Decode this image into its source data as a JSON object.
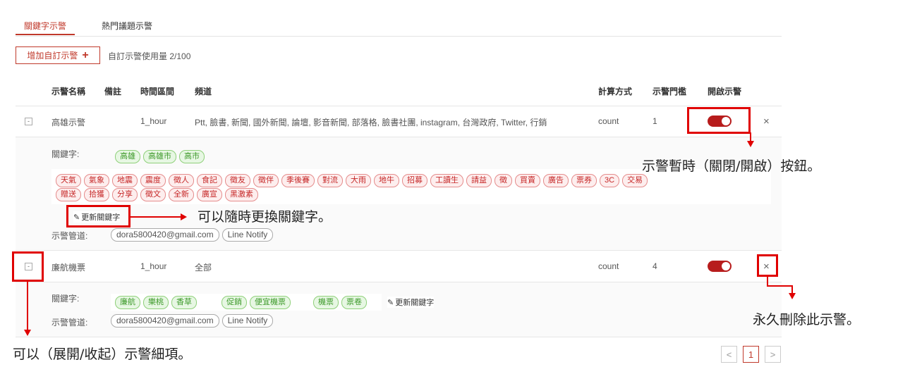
{
  "tabs": [
    {
      "label": "關鍵字示警",
      "active": true
    },
    {
      "label": "熱門議題示警",
      "active": false
    }
  ],
  "toolbar": {
    "add_label": "增加自訂示警",
    "add_icon": "plus-icon",
    "usage": "自訂示警使用量 2/100"
  },
  "columns": {
    "name": "示警名稱",
    "note": "備註",
    "interval": "時間區間",
    "channel": "頻道",
    "method": "計算方式",
    "threshold": "示警門檻",
    "enabled": "開啟示警"
  },
  "alerts": [
    {
      "expander": "-",
      "name": "高雄示警",
      "note": "",
      "interval": "1_hour",
      "channels": "Ptt, 臉書, 新聞, 國外新聞, 論壇, 影音新聞, 部落格, 臉書社團, instagram, 台灣政府, Twitter, 行銷",
      "method": "count",
      "threshold": "1",
      "enabled": true,
      "delete_icon": "×",
      "keywords_label": "關鍵字:",
      "keywords": [
        "高雄",
        "高雄市",
        "高市"
      ],
      "exclude_row1": [
        "天氣",
        "氣象",
        "地震",
        "震度",
        "徵人",
        "食記",
        "徵友",
        "徵伴",
        "季後賽",
        "對流",
        "大雨",
        "地牛",
        "招募",
        "工讀生",
        "請益",
        "徵",
        "買賣",
        "廣告",
        "票券",
        "3C",
        "交易"
      ],
      "exclude_row2": [
        "贈送",
        "拾獲",
        "分享",
        "徵文",
        "全新",
        "廣宣",
        "黑激素"
      ],
      "update_label": "更新關鍵字",
      "notify_label": "示警管道:",
      "notify": [
        "dora5800420@gmail.com",
        "Line Notify"
      ]
    },
    {
      "expander": "-",
      "name": "廉航機票",
      "note": "",
      "interval": "1_hour",
      "channels": "全部",
      "method": "count",
      "threshold": "4",
      "enabled": true,
      "delete_icon": "×",
      "keywords_label": "關鍵字:",
      "keywords_a": [
        "廉航",
        "樂桃",
        "香草"
      ],
      "keywords_b": [
        "促銷",
        "便宜機票"
      ],
      "keywords_c": [
        "機票",
        "票卷"
      ],
      "update_label": "更新關鍵字",
      "notify_label": "示警管道:",
      "notify": [
        "dora5800420@gmail.com",
        "Line Notify"
      ]
    }
  ],
  "annotations": {
    "toggle": "示警暫時（關閉/開啟）按鈕。",
    "update": "可以隨時更換關鍵字。",
    "delete": "永久刪除此示警。",
    "expand": "可以（展開/收起）示警細項。"
  },
  "pagination": {
    "prev": "<",
    "current": "1",
    "next": ">"
  },
  "colors": {
    "accent": "#c0392b",
    "annotation": "#e00000",
    "green_chip": "#3e9a2b",
    "red_chip": "#c62828"
  }
}
